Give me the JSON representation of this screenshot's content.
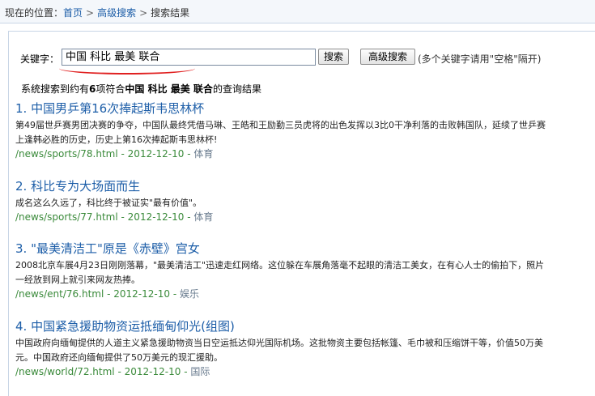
{
  "breadcrumb": {
    "prefix": "现在的位置：",
    "items": [
      "首页",
      "高级搜索"
    ],
    "current": "搜索结果",
    "separator": ">"
  },
  "search": {
    "label": "关键字：",
    "value": "中国 科比 最美 联合",
    "search_button": "搜索",
    "advanced_button": "高级搜索",
    "hint": "(多个关键字请用\"空格\"隔开)"
  },
  "summary": {
    "prefix": "系统搜索到约有",
    "count": "6",
    "middle": "项符合",
    "terms": "中国 科比 最美 联合",
    "suffix": "的查询结果"
  },
  "results": [
    {
      "index": "1.",
      "title": "中国男乒第16次捧起斯韦思林杯",
      "desc1": "第49届世乒赛男团决赛的争夺，中国队最终凭借马琳、王皓和王励勤三员虎将的出色发挥以3比0干净利落的击败韩国队，延续了世乒赛",
      "desc2": "上逢韩必胜的历史，历史上第16次捧起斯韦思林杯!",
      "url": "/news/sports/78.html",
      "date": "2012-12-10",
      "category": "体育"
    },
    {
      "index": "2.",
      "title": "科比专为大场面而生",
      "desc1": "成名这么久远了，科比终于被证实\"最有价值\"。",
      "desc2": "",
      "url": "/news/sports/77.html",
      "date": "2012-12-10",
      "category": "体育"
    },
    {
      "index": "3.",
      "title": "\"最美清洁工\"原是《赤壁》宫女",
      "desc1": "2008北京车展4月23日刚刚落幕，\"最美清洁工\"迅速走红网络。这位躲在车展角落毫不起眼的清洁工美女，在有心人士的偷拍下，照片",
      "desc2": "一经放到网上就引来网友热捧。",
      "url": "/news/ent/76.html",
      "date": "2012-12-10",
      "category": "娱乐"
    },
    {
      "index": "4.",
      "title": "中国紧急援助物资运抵缅甸仰光(组图)",
      "desc1": "中国政府向缅甸提供的人道主义紧急援助物资当日空运抵达仰光国际机场。这批物资主要包括帐篷、毛巾被和压缩饼干等，价值50万美",
      "desc2": "元。中国政府还向缅甸提供了50万美元的现汇援助。",
      "url": "/news/world/72.html",
      "date": "2012-12-10",
      "category": "国际"
    }
  ],
  "colors": {
    "link": "#1d5ea8",
    "url_green": "#3a8a3a",
    "highlight_line": "#e02020"
  }
}
